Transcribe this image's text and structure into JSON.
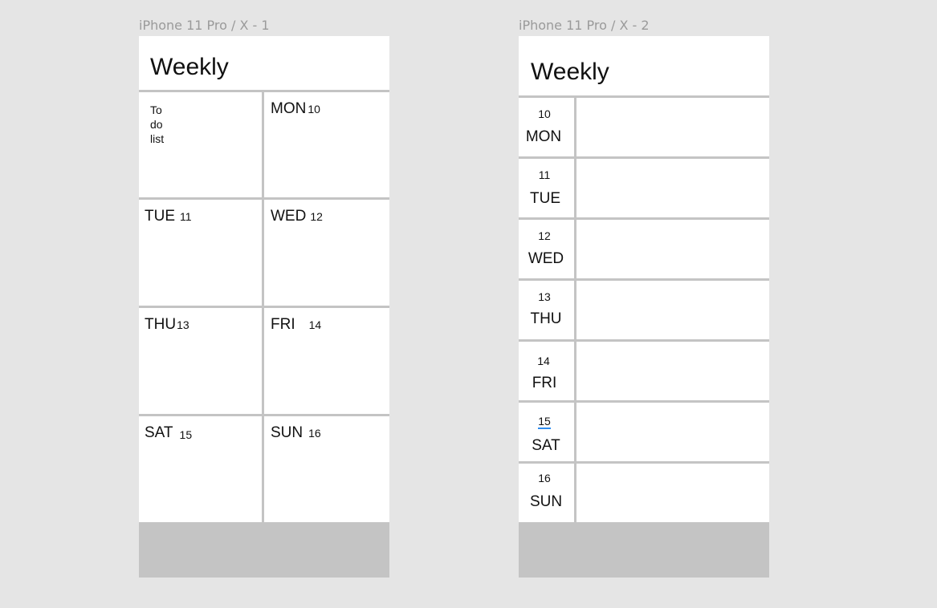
{
  "frame1": {
    "label": "iPhone 11 Pro / X - 1",
    "title": "Weekly",
    "todo": [
      "To",
      "do",
      "list"
    ],
    "cells": [
      {
        "day": "MON",
        "num": "10"
      },
      {
        "day": "TUE",
        "num": "11"
      },
      {
        "day": "WED",
        "num": "12"
      },
      {
        "day": "THU",
        "num": "13"
      },
      {
        "day": "FRI",
        "num": "14"
      },
      {
        "day": "SAT",
        "num": "15"
      },
      {
        "day": "SUN",
        "num": "16"
      }
    ]
  },
  "frame2": {
    "label": "iPhone 11 Pro / X - 2",
    "title": "Weekly",
    "rows": [
      {
        "num": "10",
        "day": "MON"
      },
      {
        "num": "11",
        "day": "TUE"
      },
      {
        "num": "12",
        "day": "WED"
      },
      {
        "num": "13",
        "day": "THU"
      },
      {
        "num": "14",
        "day": "FRI"
      },
      {
        "num": "15",
        "day": "SAT"
      },
      {
        "num": "16",
        "day": "SUN"
      }
    ]
  },
  "colors": {
    "canvas": "#e5e5e5",
    "frame": "#ffffff",
    "divider": "#c4c4c4",
    "footer": "#c4c4c4",
    "label": "#9a9a9a",
    "highlight": "#2d8cf0"
  }
}
